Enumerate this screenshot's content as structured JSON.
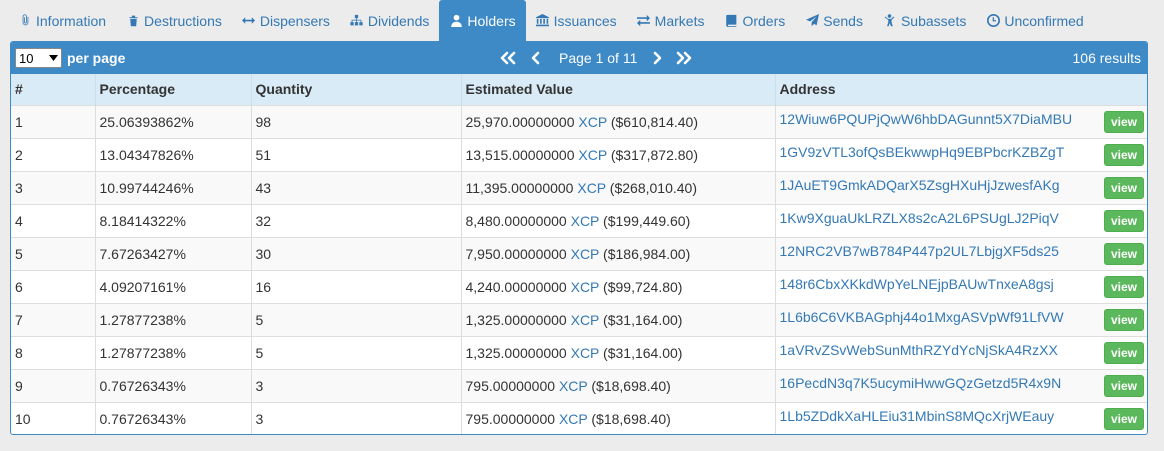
{
  "tabs": [
    {
      "label": "Information",
      "icon": "paperclip-icon"
    },
    {
      "label": "Destructions",
      "icon": "trash-icon"
    },
    {
      "label": "Dispensers",
      "icon": "arrows-horizontal-icon"
    },
    {
      "label": "Dividends",
      "icon": "sitemap-icon"
    },
    {
      "label": "Holders",
      "icon": "user-icon"
    },
    {
      "label": "Issuances",
      "icon": "bank-icon"
    },
    {
      "label": "Markets",
      "icon": "exchange-icon"
    },
    {
      "label": "Orders",
      "icon": "book-icon"
    },
    {
      "label": "Sends",
      "icon": "paper-plane-icon"
    },
    {
      "label": "Subassets",
      "icon": "child-icon"
    },
    {
      "label": "Unconfirmed",
      "icon": "clock-icon"
    }
  ],
  "active_tab": "Holders",
  "colors": {
    "accent": "#3d8ac7",
    "link": "#3479b5",
    "view_button": "#5cb85c",
    "header_row": "#d9ebf7"
  },
  "toolbar": {
    "per_page_value": "10",
    "per_page_label": "per page",
    "page_info": "Page 1 of 11",
    "results": "106 results"
  },
  "table": {
    "headers": [
      "#",
      "Percentage",
      "Quantity",
      "Estimated Value",
      "Address"
    ],
    "currency": "XCP",
    "view_label": "view",
    "rows": [
      {
        "num": "1",
        "pct": "25.06393862%",
        "qty": "98",
        "value": "25,970.00000000",
        "usd": "($610,814.40)",
        "address": "12Wiuw6PQUPjQwW6hbDAGunnt5X7DiaMBU"
      },
      {
        "num": "2",
        "pct": "13.04347826%",
        "qty": "51",
        "value": "13,515.00000000",
        "usd": "($317,872.80)",
        "address": "1GV9zVTL3ofQsBEkwwpHq9EBPbcrKZBZgT"
      },
      {
        "num": "3",
        "pct": "10.99744246%",
        "qty": "43",
        "value": "11,395.00000000",
        "usd": "($268,010.40)",
        "address": "1JAuET9GmkADQarX5ZsgHXuHjJzwesfAKg"
      },
      {
        "num": "4",
        "pct": "8.18414322%",
        "qty": "32",
        "value": "8,480.00000000",
        "usd": "($199,449.60)",
        "address": "1Kw9XguaUkLRZLX8s2cA2L6PSUgLJ2PiqV"
      },
      {
        "num": "5",
        "pct": "7.67263427%",
        "qty": "30",
        "value": "7,950.00000000",
        "usd": "($186,984.00)",
        "address": "12NRC2VB7wB784P447p2UL7LbjgXF5ds25"
      },
      {
        "num": "6",
        "pct": "4.09207161%",
        "qty": "16",
        "value": "4,240.00000000",
        "usd": "($99,724.80)",
        "address": "148r6CbxXKkdWpYeLNEjpBAUwTnxeA8gsj"
      },
      {
        "num": "7",
        "pct": "1.27877238%",
        "qty": "5",
        "value": "1,325.00000000",
        "usd": "($31,164.00)",
        "address": "1L6b6C6VKBAGphj44o1MxgASVpWf91LfVW"
      },
      {
        "num": "8",
        "pct": "1.27877238%",
        "qty": "5",
        "value": "1,325.00000000",
        "usd": "($31,164.00)",
        "address": "1aVRvZSvWebSunMthRZYdYcNjSkA4RzXX"
      },
      {
        "num": "9",
        "pct": "0.76726343%",
        "qty": "3",
        "value": "795.00000000",
        "usd": "($18,698.40)",
        "address": "16PecdN3q7K5ucymiHwwGQzGetzd5R4x9N"
      },
      {
        "num": "10",
        "pct": "0.76726343%",
        "qty": "3",
        "value": "795.00000000",
        "usd": "($18,698.40)",
        "address": "1Lb5ZDdkXaHLEiu31MbinS8MQcXrjWEauy"
      }
    ]
  }
}
